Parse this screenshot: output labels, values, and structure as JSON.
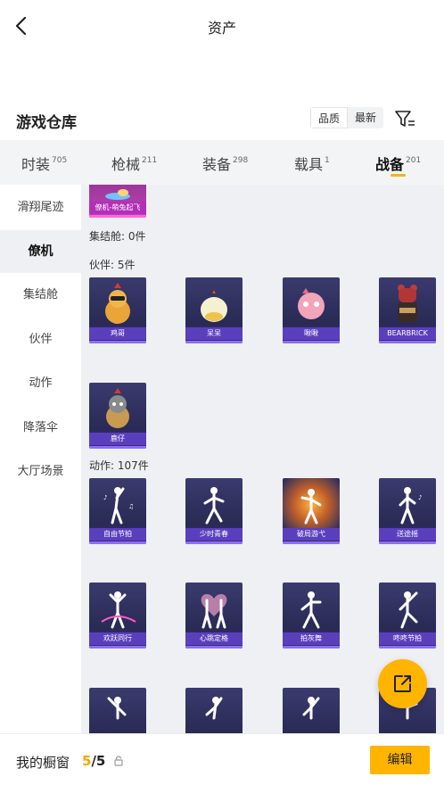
{
  "header": {
    "title": "资产"
  },
  "warehouse": {
    "title": "游戏仓库",
    "sort": [
      "品质",
      "最新"
    ]
  },
  "tabs": [
    {
      "label": "时装",
      "count": "705"
    },
    {
      "label": "枪械",
      "count": "211"
    },
    {
      "label": "装备",
      "count": "298"
    },
    {
      "label": "载具",
      "count": "1"
    },
    {
      "label": "战备",
      "count": "201"
    }
  ],
  "sidebar": [
    "滑翔尾迹",
    "僚机",
    "集结舱",
    "伙伴",
    "动作",
    "降落伞",
    "大厅场景"
  ],
  "content": {
    "top_card": "僚机-萌兔起飞",
    "capsule_label": "集结舱: 0件",
    "partner_label": "伙伴: 5件",
    "partners": [
      "鸡哥",
      "呆呆",
      "啾啾",
      "BEARBRICK",
      "鹿仔"
    ],
    "emote_label": "动作: 107件",
    "emotes": [
      "自由节拍",
      "少时青春",
      "破局游弋",
      "送途摇",
      "欢跃同行",
      "心跳定格",
      "拍灰舞",
      "咚咚节拍"
    ]
  },
  "bottom": {
    "label": "我的橱窗",
    "count": "5",
    "total": "/5",
    "edit": "编辑"
  },
  "colors": {
    "accent": "#ffb400",
    "card": "#2e2e5e",
    "card_caption": "#5a3fbd"
  },
  "icons": [
    "back-icon",
    "filter-icon",
    "share-icon",
    "lock-icon"
  ]
}
